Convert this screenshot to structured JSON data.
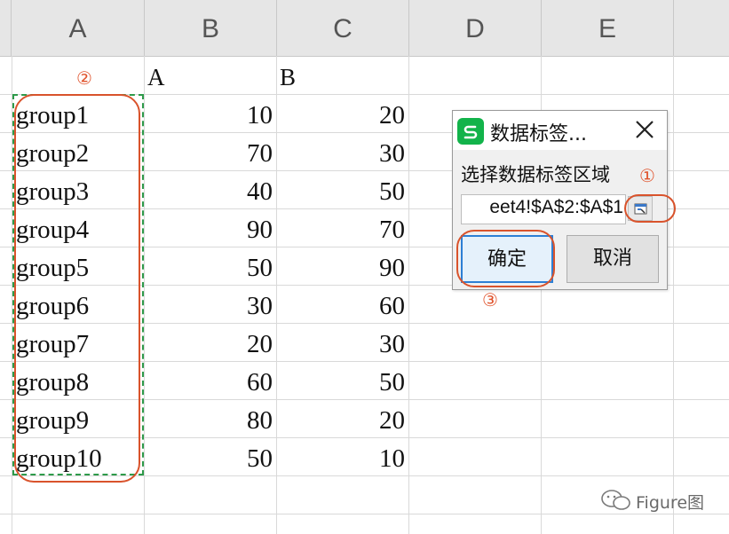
{
  "columns": [
    "A",
    "B",
    "C",
    "D",
    "E"
  ],
  "header_row": {
    "b": "A",
    "c": "B"
  },
  "rows": [
    {
      "label": "group1",
      "b": "10",
      "c": "20"
    },
    {
      "label": "group2",
      "b": "70",
      "c": "30"
    },
    {
      "label": "group3",
      "b": "40",
      "c": "50"
    },
    {
      "label": "group4",
      "b": "90",
      "c": "70"
    },
    {
      "label": "group5",
      "b": "50",
      "c": "90"
    },
    {
      "label": "group6",
      "b": "30",
      "c": "60"
    },
    {
      "label": "group7",
      "b": "20",
      "c": "30"
    },
    {
      "label": "group8",
      "b": "60",
      "c": "50"
    },
    {
      "label": "group9",
      "b": "80",
      "c": "20"
    },
    {
      "label": "group10",
      "b": "50",
      "c": "10"
    }
  ],
  "dialog": {
    "title": "数据标签...",
    "label": "选择数据标签区域",
    "range_value": "eet4!$A$2:$A$1",
    "ok_label": "确定",
    "cancel_label": "取消",
    "app_icon": "wps-spreadsheet-icon",
    "close_icon": "close-icon",
    "collapse_icon": "range-select-icon"
  },
  "annotations": {
    "step1": "①",
    "step2": "②",
    "step3": "③"
  },
  "watermark": "Figure图",
  "colors": {
    "annotation": "#d9532c",
    "selection": "#2e9a4a",
    "app_icon": "#12b34a",
    "header_bg": "#e6e6e6"
  }
}
